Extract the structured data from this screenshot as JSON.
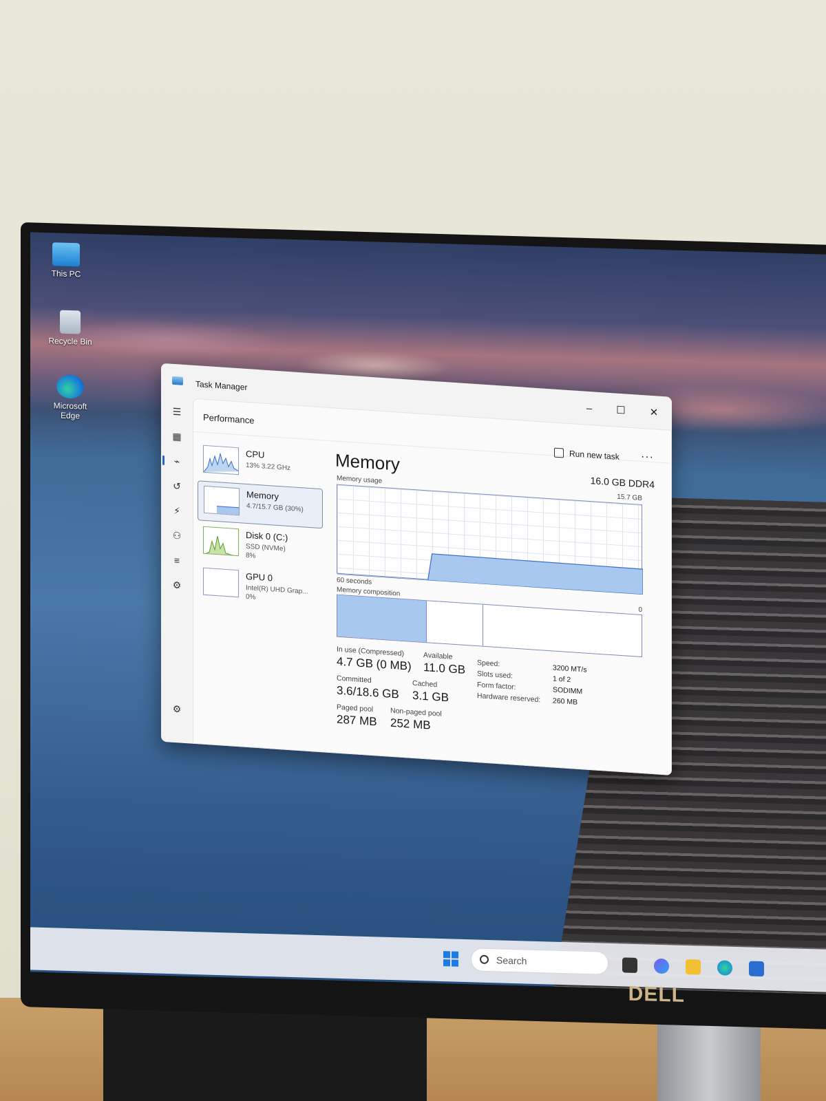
{
  "desktop": {
    "icons": [
      {
        "label": "This PC"
      },
      {
        "label": "Recycle Bin"
      },
      {
        "label": "Microsoft Edge"
      }
    ]
  },
  "taskbar": {
    "search_placeholder": "Search"
  },
  "monitor": {
    "brand": "DELL"
  },
  "task_manager": {
    "window_title": "Task Manager",
    "window_controls": {
      "minimize": "–",
      "maximize": "☐",
      "close": "✕"
    },
    "page_title": "Performance",
    "run_new_task": "Run new task",
    "more": "···",
    "resources": [
      {
        "name": "CPU",
        "sub": "13% 3.22 GHz"
      },
      {
        "name": "Memory",
        "sub": "4.7/15.7 GB (30%)",
        "selected": true
      },
      {
        "name": "Disk 0 (C:)",
        "sub": "SSD (NVMe)",
        "sub2": "8%"
      },
      {
        "name": "GPU 0",
        "sub": "Intel(R) UHD Grap...",
        "sub2": "0%"
      }
    ],
    "detail": {
      "title": "Memory",
      "spec": "16.0 GB DDR4",
      "usage_label": "Memory usage",
      "usage_max": "15.7 GB",
      "time_span": "60 seconds",
      "min_value": "0",
      "composition_label": "Memory composition",
      "usage_fraction": 0.3,
      "stats": {
        "in_use_label": "In use (Compressed)",
        "in_use_value": "4.7 GB (0 MB)",
        "available_label": "Available",
        "available_value": "11.0 GB",
        "committed_label": "Committed",
        "committed_value": "3.6/18.6 GB",
        "cached_label": "Cached",
        "cached_value": "3.1 GB",
        "paged_pool_label": "Paged pool",
        "paged_pool_value": "287 MB",
        "non_paged_pool_label": "Non-paged pool",
        "non_paged_pool_value": "252 MB"
      },
      "specs": {
        "speed_label": "Speed:",
        "speed_value": "3200 MT/s",
        "slots_label": "Slots used:",
        "slots_value": "1 of 2",
        "form_label": "Form factor:",
        "form_value": "SODIMM",
        "reserved_label": "Hardware reserved:",
        "reserved_value": "260 MB"
      }
    }
  },
  "colors": {
    "graph_fill": "#a9c8ef",
    "graph_line": "#3b6fc4",
    "accent": "#2a64c8"
  }
}
